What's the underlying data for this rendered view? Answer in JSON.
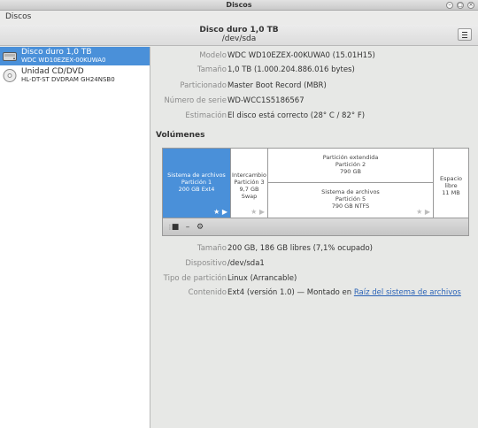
{
  "window": {
    "title": "Discos",
    "close": "×",
    "max": "□",
    "min": "–"
  },
  "menubar": {
    "menu": "Discos"
  },
  "header": {
    "title": "Disco duro 1,0 TB",
    "subtitle": "/dev/sda"
  },
  "sidebar": {
    "drives": [
      {
        "name": "Disco duro 1,0 TB",
        "sub": "WDC WD10EZEX-00KUWA0",
        "selected": true,
        "icon": "hard-disk-icon"
      },
      {
        "name": "Unidad CD/DVD",
        "sub": "HL-DT-ST DVDRAM GH24NSB0",
        "selected": false,
        "icon": "optical-disc-icon"
      }
    ]
  },
  "drive_info": [
    {
      "k": "Modelo",
      "v": "WDC WD10EZEX-00KUWA0 (15.01H15)"
    },
    {
      "k": "Tamaño",
      "v": "1,0 TB (1.000.204.886.016 bytes)"
    },
    {
      "k": "Particionado",
      "v": "Master Boot Record (MBR)"
    },
    {
      "k": "Número de serie",
      "v": "WD-WCC1S5186567"
    },
    {
      "k": "Estimación",
      "v": "El disco está correcto (28° C / 82° F)"
    }
  ],
  "volumes": {
    "heading": "Volúmenes",
    "partitions": [
      {
        "l1": "Sistema de archivos",
        "l2": "Partición 1",
        "l3": "200 GB Ext4",
        "stars": "★ ▶"
      },
      {
        "l1": "Intercambio",
        "l2": "Partición 3",
        "l3": "9,7 GB Swap",
        "stars": "★ ▶"
      },
      {
        "l1": "Partición extendida",
        "l2": "Partición 2",
        "l3": "790 GB"
      },
      {
        "l1": "Sistema de archivos",
        "l2": "Partición 5",
        "l3": "790 GB NTFS",
        "stars": "★ ▶"
      },
      {
        "l1": "Espacio libre",
        "l2": "11 MB"
      }
    ],
    "tools": {
      "stop": "■",
      "remove": "–",
      "settings": "⚙"
    }
  },
  "partition_info": [
    {
      "k": "Tamaño",
      "v": "200 GB, 186 GB libres (7,1% ocupado)"
    },
    {
      "k": "Dispositivo",
      "v": "/dev/sda1"
    },
    {
      "k": "Tipo de partición",
      "v": "Linux (Arrancable)"
    },
    {
      "k": "Contenido",
      "v": "Ext4 (versión 1.0) — Montado en ",
      "link": "Raíz del sistema de archivos"
    }
  ]
}
